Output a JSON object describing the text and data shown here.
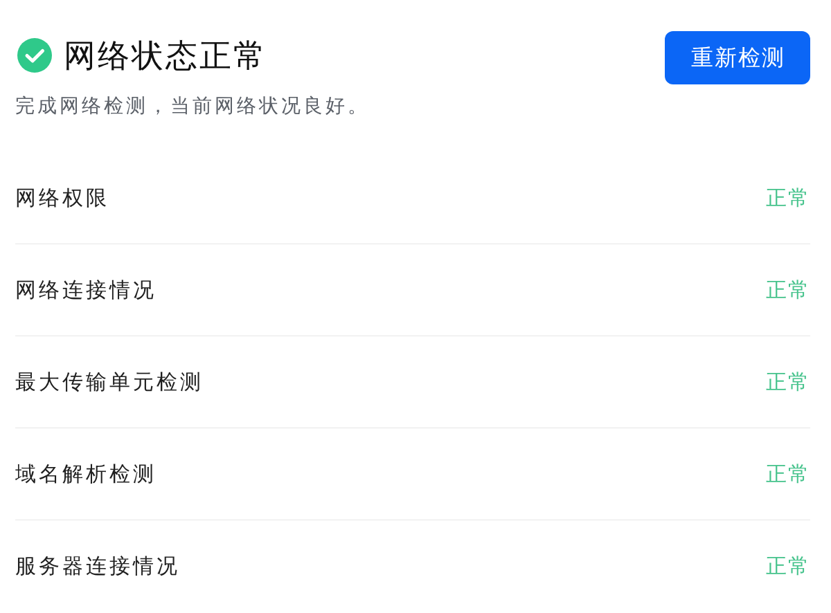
{
  "header": {
    "title": "网络状态正常",
    "subtitle": "完成网络检测，当前网络状况良好。",
    "button": "重新检测"
  },
  "checks": [
    {
      "name": "网络权限",
      "status": "正常"
    },
    {
      "name": "网络连接情况",
      "status": "正常"
    },
    {
      "name": "最大传输单元检测",
      "status": "正常"
    },
    {
      "name": "域名解析检测",
      "status": "正常"
    },
    {
      "name": "服务器连接情况",
      "status": "正常"
    }
  ]
}
